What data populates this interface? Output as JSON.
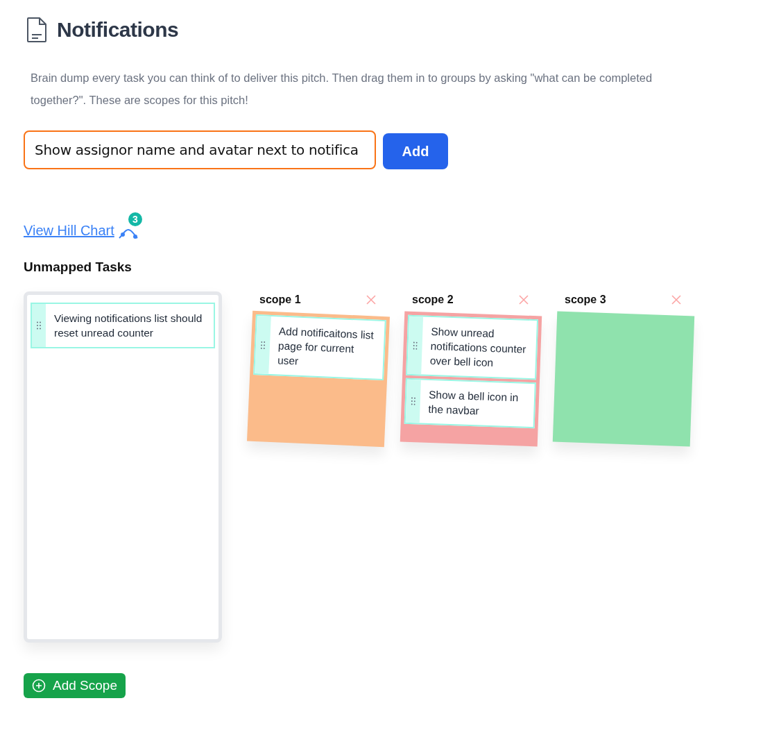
{
  "header": {
    "title": "Notifications"
  },
  "description": "Brain dump every task you can think of to deliver this pitch. Then drag them in to groups by asking \"what can be completed together?\". These are scopes for this pitch!",
  "task_input": {
    "value": "Show assignor name and avatar next to notifica",
    "focused": true
  },
  "add_button": "Add",
  "hill_chart_link": {
    "label": "View Hill Chart",
    "badge": "3"
  },
  "unmapped": {
    "title": "Unmapped Tasks",
    "tasks": [
      "Viewing notifications list should reset unread counter"
    ]
  },
  "scopes": [
    {
      "name": "scope 1",
      "color": "#fbbb8a",
      "tasks": [
        "Add notificaitons list page for current user"
      ]
    },
    {
      "name": "scope 2",
      "color": "#f5a3a3",
      "tasks": [
        "Show unread notifications counter over bell icon",
        "Show a bell icon in the navbar"
      ]
    },
    {
      "name": "scope 3",
      "color": "#8fe2ad"
    }
  ],
  "add_scope_button": "Add Scope"
}
